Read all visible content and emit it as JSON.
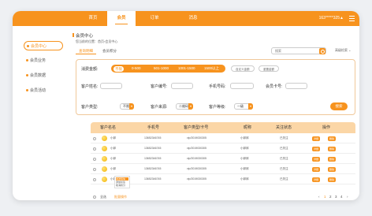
{
  "nav": {
    "items": [
      "首页",
      "会员",
      "订单",
      "消息"
    ],
    "active_index": 1,
    "user": "163*****325▲",
    "accent": "#f7931e"
  },
  "sidebar": {
    "items": [
      {
        "label": "会员中心",
        "active": true
      },
      {
        "label": "会员业务",
        "active": false
      },
      {
        "label": "会员数据",
        "active": false
      },
      {
        "label": "会员活动",
        "active": false
      }
    ]
  },
  "header": {
    "title": "会员中心",
    "breadcrumb": "您当前的位置：首页›会员中心",
    "tabs": [
      "查询明细",
      "会员积分"
    ],
    "active_tab": 0,
    "search_placeholder": "搜索",
    "advanced_label": "高级检索 ⌄"
  },
  "filters": {
    "amount_label": "消费金额:",
    "amount_options": [
      "不限",
      "0-500",
      "501-1000",
      "1001-1500",
      "1500以上"
    ],
    "amount_selected": 0,
    "custom_btn": "自定义金额",
    "reset_btn": "重置金额",
    "customer_name_label": "客户姓名:",
    "customer_no_label": "客户编号:",
    "phone_label": "手机号码:",
    "member_card_label": "会员卡号:",
    "customer_type_label": "客户类型:",
    "customer_type_value": "不限",
    "customer_source_label": "客户来源:",
    "customer_source_value": "二维码",
    "customer_level_label": "客户等级:",
    "customer_level_value": "一级",
    "query_btn": "搜索"
  },
  "table": {
    "headers": [
      "客户名名",
      "手机号",
      "客户类型/卡号",
      "昵称",
      "关注状态",
      "操作"
    ],
    "rows": [
      {
        "name": "小邱",
        "phone": "13652346745",
        "card": "vip/2019030305",
        "nick": "小邱邱",
        "status": "已关注"
      },
      {
        "name": "小邱",
        "phone": "13652346745",
        "card": "vip/2019030305",
        "nick": "小邱邱",
        "status": "已关注"
      },
      {
        "name": "小邱",
        "phone": "13652346745",
        "card": "vip/2019030305",
        "nick": "小邱邱",
        "status": "已关注"
      },
      {
        "name": "小邱",
        "phone": "13652346745",
        "card": "vip/2019030305",
        "nick": "小邱邱",
        "status": "已关注"
      },
      {
        "name": "小邱",
        "phone": "13652346745",
        "card": "vip/2019030305",
        "nick": "小邱邱",
        "status": "已关注"
      }
    ],
    "action_edit": "详细",
    "action_delete": "删除",
    "row_popup": [
      "发送短信",
      "添加标签",
      "取消积分"
    ],
    "footer_select_all": "全选",
    "footer_batch": "批量操作",
    "pages": [
      "‹",
      "1",
      "2",
      "3",
      "4",
      "›"
    ],
    "active_page": "1"
  }
}
